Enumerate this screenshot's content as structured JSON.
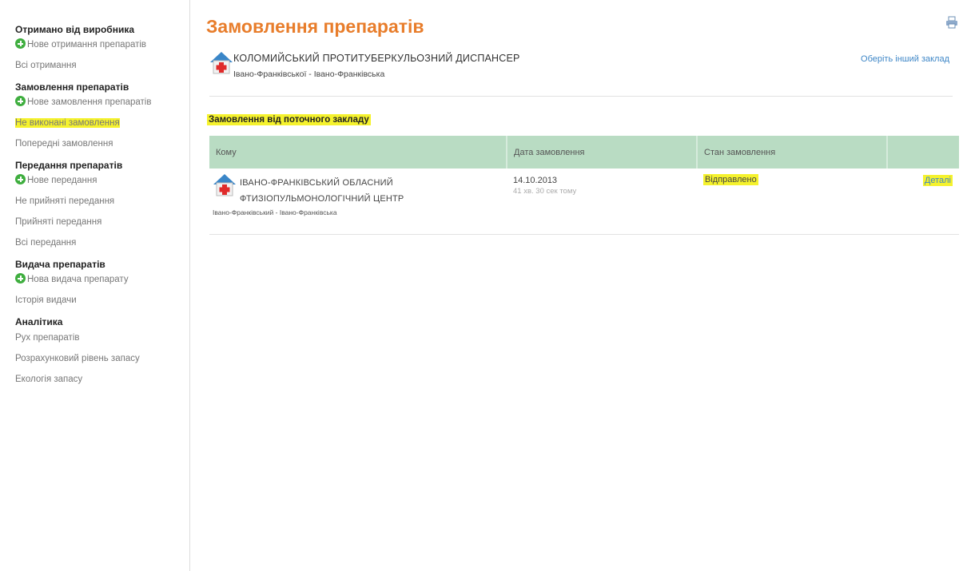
{
  "sidebar": {
    "received": {
      "title": "Отримано від виробника",
      "new_label": "Нове отримання препаратів",
      "all_label": "Всі отримання"
    },
    "orders": {
      "title": "Замовлення препаратів",
      "new_label": "Нове замовлення препаратів",
      "unfulfilled_label": "Не виконані замовлення",
      "previous_label": "Попередні замовлення"
    },
    "transfers": {
      "title": "Передання препаратів",
      "new_label": "Нове передання",
      "not_accepted_label": "Не прийняті передання",
      "accepted_label": "Прийняті передання",
      "all_label": "Всі передання"
    },
    "dispense": {
      "title": "Видача препаратів",
      "new_label": "Нова видача препарату",
      "history_label": "Історія видачи"
    },
    "analytics": {
      "title": "Аналітика",
      "movement_label": "Рух препаратів",
      "stock_level_label": "Розрахунковий рівень запасу",
      "ecology_label": "Екологія запасу"
    }
  },
  "main": {
    "title": "Замовлення препаратів",
    "org": {
      "name": "КОЛОМИЙСЬКИЙ ПРОТИТУБЕРКУЛЬОЗНИЙ ДИСПАНСЕР",
      "region": "Івано-Франківської - Івано-Франківська",
      "change_link": "Оберіть інший заклад"
    },
    "section_heading": "Замовлення від поточного закладу",
    "table": {
      "headers": {
        "to": "Кому",
        "date": "Дата замовлення",
        "status": "Стан замовлення"
      },
      "rows": [
        {
          "org_line1": "ІВАНО-ФРАНКІВСЬКИЙ ОБЛАСНИЙ",
          "org_line2": "ФТИЗІОПУЛЬМОНОЛОГІЧНИЙ ЦЕНТР",
          "region": "Івано-Франківський - Івано-Франківська",
          "date": "14.10.2013",
          "date_relative": "41 хв. 30 сек тому",
          "status": "Відправлено",
          "details_label": "Деталі"
        }
      ]
    }
  },
  "colors": {
    "title_orange": "#e87d2b",
    "table_header": "#b9dcc3",
    "highlight": "#f5f22d",
    "link_blue": "#3f87c7",
    "plus_green": "#3fae3f"
  },
  "icons": {
    "print": "printer-icon",
    "hospital": "hospital-icon",
    "add": "plus-circle-icon"
  }
}
